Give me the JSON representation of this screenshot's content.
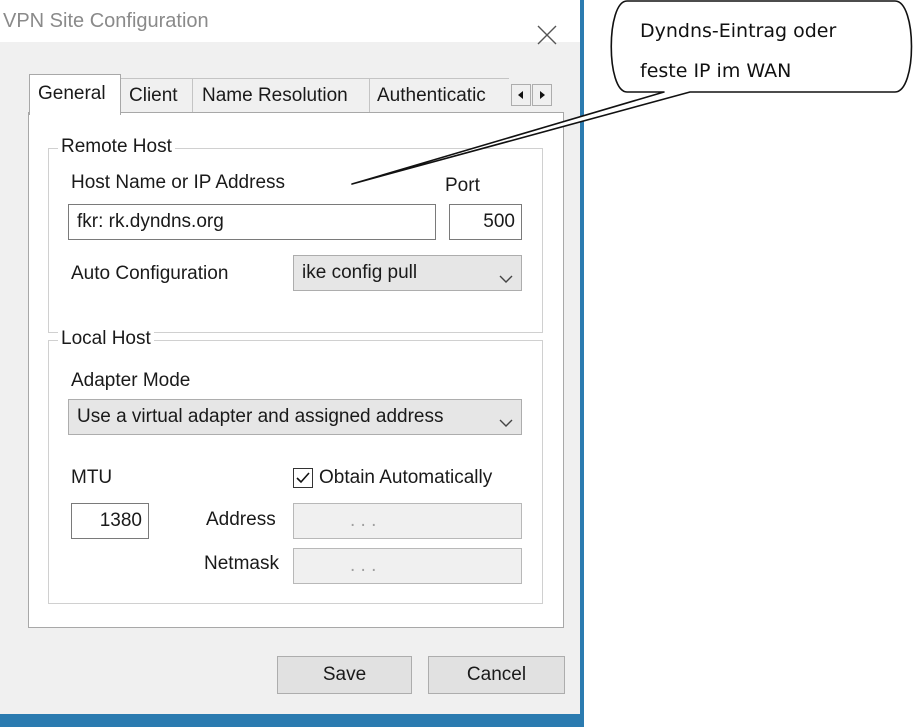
{
  "window": {
    "title": "VPN Site Configuration"
  },
  "tabs": [
    {
      "label": "General",
      "active": true
    },
    {
      "label": "Client",
      "active": false
    },
    {
      "label": "Name Resolution",
      "active": false
    },
    {
      "label": "Authenticatic",
      "active": false
    }
  ],
  "tab_scroll": {
    "left_icon": "triangle-left",
    "right_icon": "triangle-right"
  },
  "remote_host": {
    "legend": "Remote Host",
    "host_label": "Host Name or IP Address",
    "host_value": "fkr:        rk.dyndns.org",
    "port_label": "Port",
    "port_value": "500",
    "auto_config_label": "Auto Configuration",
    "auto_config_value": "ike config pull"
  },
  "local_host": {
    "legend": "Local Host",
    "adapter_mode_label": "Adapter Mode",
    "adapter_mode_value": "Use a virtual adapter and assigned address",
    "mtu_label": "MTU",
    "mtu_value": "1380",
    "obtain_auto_label": "Obtain Automatically",
    "obtain_auto_checked": true,
    "address_label": "Address",
    "address_value": ".     .     .",
    "netmask_label": "Netmask",
    "netmask_value": ".     .     ."
  },
  "buttons": {
    "save": "Save",
    "cancel": "Cancel"
  },
  "annotation": {
    "line1": "Dyndns-Eintrag oder",
    "line2": "feste IP im WAN"
  },
  "colors": {
    "window_border": "#2b7bb0",
    "dialog_bg": "#f0f0f0",
    "title_text": "#8a8a8a"
  }
}
